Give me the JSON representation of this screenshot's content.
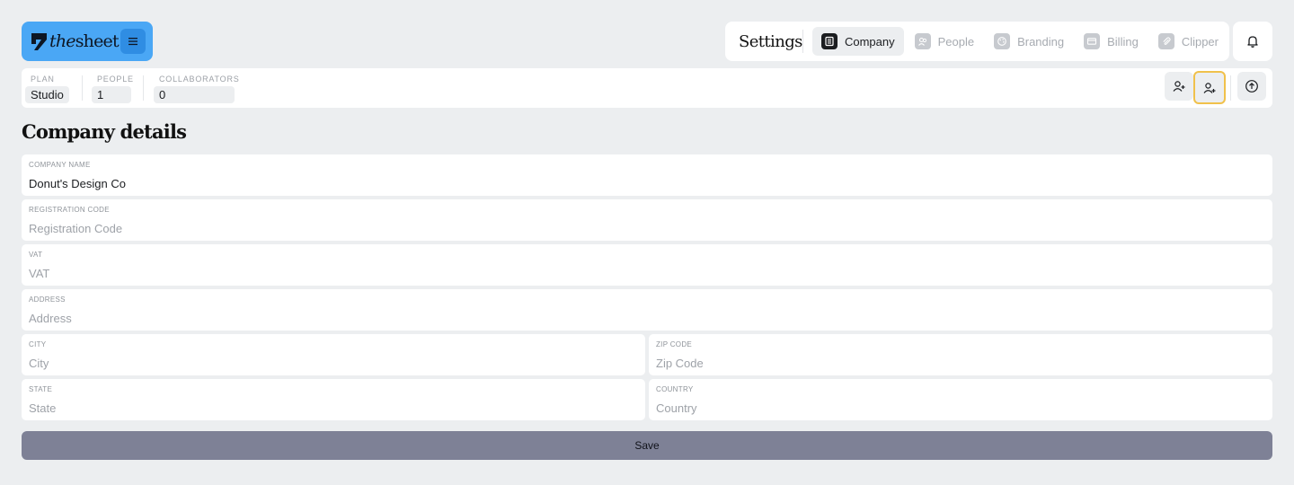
{
  "brand": {
    "prefix": "the",
    "name": "sheet",
    "menu_icon": "hamburger-icon",
    "color": "#4aa7f5"
  },
  "settings": {
    "title": "Settings",
    "tabs": [
      {
        "label": "Company",
        "icon": "company-icon",
        "active": true
      },
      {
        "label": "People",
        "icon": "people-icon",
        "active": false
      },
      {
        "label": "Branding",
        "icon": "palette-icon",
        "active": false
      },
      {
        "label": "Billing",
        "icon": "card-icon",
        "active": false
      },
      {
        "label": "Clipper",
        "icon": "paperclip-icon",
        "active": false
      }
    ]
  },
  "notifications": {
    "icon": "bell-icon"
  },
  "stats": {
    "plan": {
      "label": "Plan",
      "value": "Studio"
    },
    "people": {
      "label": "People",
      "value": "1"
    },
    "collaborators": {
      "label": "Collaborators",
      "value": "0"
    }
  },
  "actions": {
    "invite_person_icon": "user-plus-icon",
    "add_collaborator_icon": "user-plus-icon",
    "upgrade_icon": "arrow-up-circle-icon"
  },
  "company_details": {
    "title": "Company details",
    "fields": {
      "company_name": {
        "label": "Company Name",
        "value": "Donut's Design Co",
        "placeholder": "Company Name"
      },
      "registration_code": {
        "label": "Registration Code",
        "value": "",
        "placeholder": "Registration Code"
      },
      "vat": {
        "label": "VAT",
        "value": "",
        "placeholder": "VAT"
      },
      "address": {
        "label": "Address",
        "value": "",
        "placeholder": "Address"
      },
      "city": {
        "label": "City",
        "value": "",
        "placeholder": "City"
      },
      "zip_code": {
        "label": "Zip Code",
        "value": "",
        "placeholder": "Zip Code"
      },
      "state": {
        "label": "State",
        "value": "",
        "placeholder": "State"
      },
      "country": {
        "label": "Country",
        "value": "",
        "placeholder": "Country"
      }
    },
    "save_label": "Save"
  },
  "colors": {
    "background": "#eceef0",
    "save_button": "#7e8196",
    "focus_ring": "#f0c14b"
  }
}
